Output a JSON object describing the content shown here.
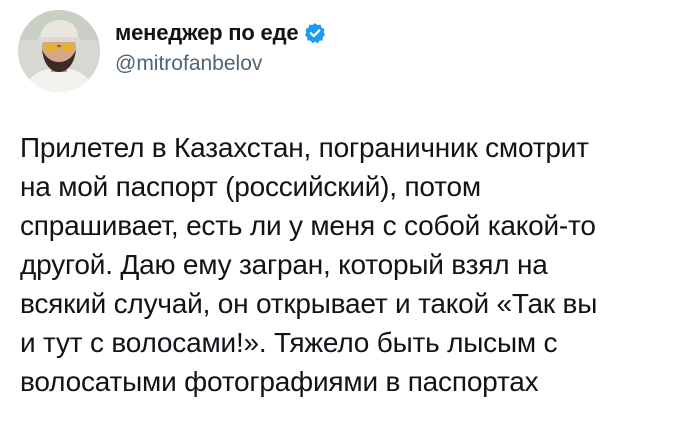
{
  "tweet": {
    "author": {
      "display_name": "менеджер по еде",
      "handle": "@mitrofanbelov",
      "verified": true,
      "avatar_icon": "avatar-photo-man-with-sunglasses",
      "verified_icon": "verified-badge-icon",
      "verified_color": "#1d9bf0"
    },
    "text_lines": [
      "Прилетел в Казахстан, пограничник смотрит",
      "на мой паспорт (российский), потом",
      "спрашивает, есть ли у меня с собой какой-то",
      "другой. Даю ему загран, который взял на",
      "всякий случай, он открывает и такой «Так вы",
      "и тут с волосами!». Тяжело быть лысым с",
      "волосатыми фотографиями в паспортах"
    ]
  }
}
